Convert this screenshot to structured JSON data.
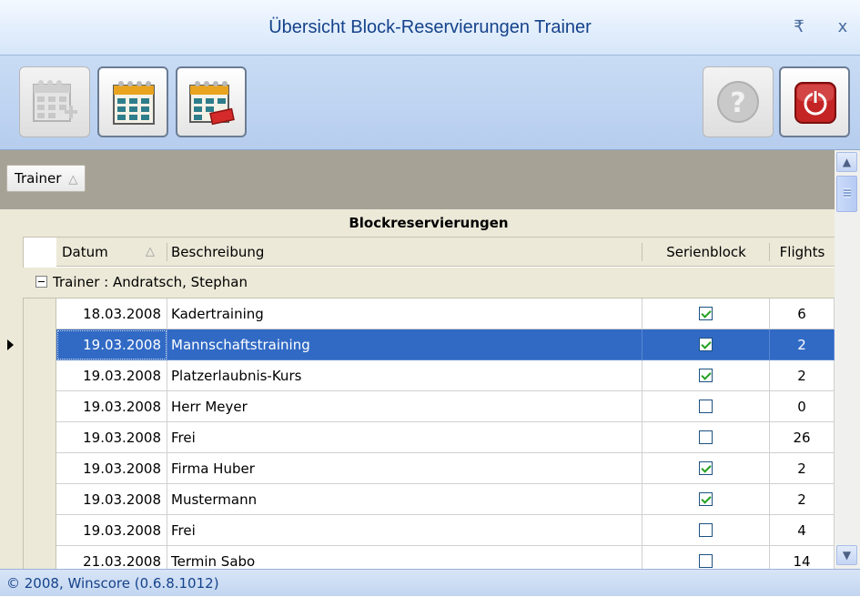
{
  "window": {
    "title": "Übersicht Block-Reservierungen Trainer",
    "pin_glyph": "₹",
    "close_glyph": "x"
  },
  "toolbar": {
    "buttons": [
      {
        "icon": "calendar-add-icon",
        "enabled": false
      },
      {
        "icon": "calendar-icon",
        "enabled": true
      },
      {
        "icon": "calendar-delete-icon",
        "enabled": true
      },
      {
        "icon": "help-icon",
        "enabled": false
      },
      {
        "icon": "power-icon",
        "enabled": true
      }
    ]
  },
  "group_panel": {
    "chip_label": "Trainer",
    "sort_glyph": "△"
  },
  "grid": {
    "band_title": "Blockreservierungen",
    "columns": {
      "datum": "Datum",
      "beschreibung": "Beschreibung",
      "serienblock": "Serienblock",
      "flights": "Flights"
    },
    "sort_glyph": "△",
    "group_row": "Trainer : Andratsch,  Stephan",
    "rows": [
      {
        "datum": "18.03.2008",
        "beschreibung": "Kadertraining",
        "serienblock": true,
        "flights": "6",
        "selected": false
      },
      {
        "datum": "19.03.2008",
        "beschreibung": "Mannschaftstraining",
        "serienblock": true,
        "flights": "2",
        "selected": true
      },
      {
        "datum": "19.03.2008",
        "beschreibung": "Platzerlaubnis-Kurs",
        "serienblock": true,
        "flights": "2",
        "selected": false
      },
      {
        "datum": "19.03.2008",
        "beschreibung": "Herr Meyer",
        "serienblock": false,
        "flights": "0",
        "selected": false
      },
      {
        "datum": "19.03.2008",
        "beschreibung": "Frei",
        "serienblock": false,
        "flights": "26",
        "selected": false
      },
      {
        "datum": "19.03.2008",
        "beschreibung": "Firma Huber",
        "serienblock": true,
        "flights": "2",
        "selected": false
      },
      {
        "datum": "19.03.2008",
        "beschreibung": "Mustermann",
        "serienblock": true,
        "flights": "2",
        "selected": false
      },
      {
        "datum": "19.03.2008",
        "beschreibung": "Frei",
        "serienblock": false,
        "flights": "4",
        "selected": false
      },
      {
        "datum": "21.03.2008",
        "beschreibung": "Termin Sabo",
        "serienblock": false,
        "flights": "14",
        "selected": false
      }
    ]
  },
  "status": {
    "text": "© 2008, Winscore  (0.6.8.1012)"
  },
  "colors": {
    "selection": "#316ac5",
    "title_text": "#15428b",
    "check": "#21a121"
  }
}
